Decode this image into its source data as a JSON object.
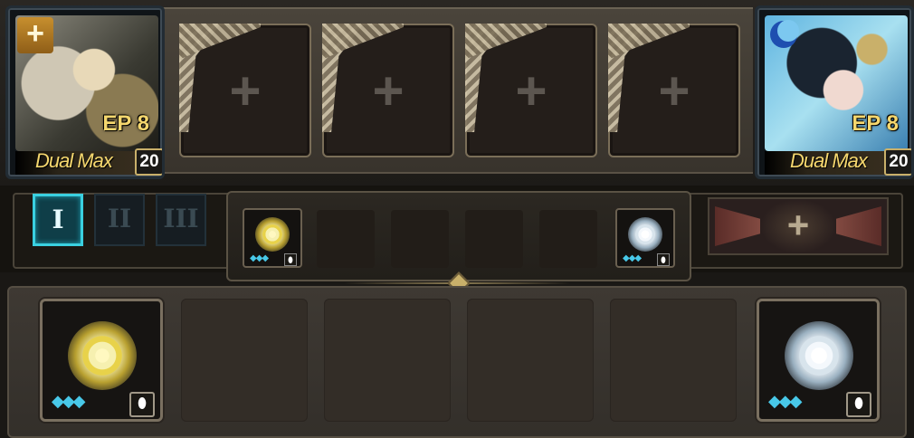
{
  "party": {
    "left_hero": {
      "level": "EP 8",
      "name": "Dual Max",
      "badge": "20",
      "corner_icon": "plus-icon"
    },
    "right_hero": {
      "level": "EP 8",
      "name": "Dual Max",
      "badge": "20",
      "corner_icon": "moon-icon"
    },
    "empty_slots": [
      {
        "label": "+"
      },
      {
        "label": "+"
      },
      {
        "label": "+"
      },
      {
        "label": "+"
      }
    ]
  },
  "tiers": [
    {
      "label": "I",
      "active": true
    },
    {
      "label": "II",
      "active": false
    },
    {
      "label": "III",
      "active": false
    }
  ],
  "equip_tray": {
    "left_gem": {
      "type": "gold",
      "stars": "◆◆◆",
      "shield": "⬮"
    },
    "right_gem": {
      "type": "silver",
      "stars": "◆◆◆",
      "shield": "⬮"
    }
  },
  "add_button": {
    "label": "+"
  },
  "inventory": {
    "left_gem": {
      "type": "gold",
      "stars": "◆◆◆",
      "shield": "⬮"
    },
    "right_gem": {
      "type": "silver",
      "stars": "◆◆◆",
      "shield": "⬮"
    }
  },
  "colors": {
    "accent_teal": "#3ad0e0",
    "gold_text": "#f5d76e",
    "diamond_blue": "#48c8e8"
  }
}
